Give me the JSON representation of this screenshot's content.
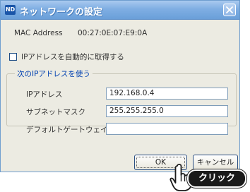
{
  "window": {
    "title": "ネットワークの設定",
    "icon_text": "ND"
  },
  "mac": {
    "label": "MAC Address",
    "value": "00:27:0E:07:E9:0A"
  },
  "auto_ip": {
    "label": "IPアドレスを自動的に取得する",
    "checked": false
  },
  "manual_ip": {
    "legend": "次のIPアドレスを使う",
    "fields": [
      {
        "label": "IPアドレス",
        "value": "192.168.0.4"
      },
      {
        "label": "サブネットマスク",
        "value": "255.255.255.0"
      },
      {
        "label": "デフォルトゲートウェイ",
        "value": ""
      }
    ]
  },
  "buttons": {
    "ok": "OK",
    "cancel": "キャンセル"
  },
  "annotation": {
    "click_label": "クリック"
  },
  "colors": {
    "titlebar": "#7faee3",
    "legend_text": "#0040b0",
    "dialog_bg": "#ecebe2"
  }
}
